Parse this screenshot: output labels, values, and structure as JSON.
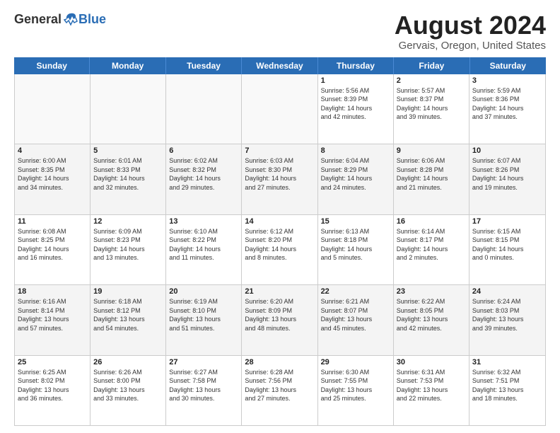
{
  "logo": {
    "general": "General",
    "blue": "Blue"
  },
  "title": "August 2024",
  "subtitle": "Gervais, Oregon, United States",
  "header_days": [
    "Sunday",
    "Monday",
    "Tuesday",
    "Wednesday",
    "Thursday",
    "Friday",
    "Saturday"
  ],
  "rows": [
    [
      {
        "day": "",
        "text": "",
        "empty": true
      },
      {
        "day": "",
        "text": "",
        "empty": true
      },
      {
        "day": "",
        "text": "",
        "empty": true
      },
      {
        "day": "",
        "text": "",
        "empty": true
      },
      {
        "day": "1",
        "text": "Sunrise: 5:56 AM\nSunset: 8:39 PM\nDaylight: 14 hours\nand 42 minutes."
      },
      {
        "day": "2",
        "text": "Sunrise: 5:57 AM\nSunset: 8:37 PM\nDaylight: 14 hours\nand 39 minutes."
      },
      {
        "day": "3",
        "text": "Sunrise: 5:59 AM\nSunset: 8:36 PM\nDaylight: 14 hours\nand 37 minutes."
      }
    ],
    [
      {
        "day": "4",
        "text": "Sunrise: 6:00 AM\nSunset: 8:35 PM\nDaylight: 14 hours\nand 34 minutes."
      },
      {
        "day": "5",
        "text": "Sunrise: 6:01 AM\nSunset: 8:33 PM\nDaylight: 14 hours\nand 32 minutes."
      },
      {
        "day": "6",
        "text": "Sunrise: 6:02 AM\nSunset: 8:32 PM\nDaylight: 14 hours\nand 29 minutes."
      },
      {
        "day": "7",
        "text": "Sunrise: 6:03 AM\nSunset: 8:30 PM\nDaylight: 14 hours\nand 27 minutes."
      },
      {
        "day": "8",
        "text": "Sunrise: 6:04 AM\nSunset: 8:29 PM\nDaylight: 14 hours\nand 24 minutes."
      },
      {
        "day": "9",
        "text": "Sunrise: 6:06 AM\nSunset: 8:28 PM\nDaylight: 14 hours\nand 21 minutes."
      },
      {
        "day": "10",
        "text": "Sunrise: 6:07 AM\nSunset: 8:26 PM\nDaylight: 14 hours\nand 19 minutes."
      }
    ],
    [
      {
        "day": "11",
        "text": "Sunrise: 6:08 AM\nSunset: 8:25 PM\nDaylight: 14 hours\nand 16 minutes."
      },
      {
        "day": "12",
        "text": "Sunrise: 6:09 AM\nSunset: 8:23 PM\nDaylight: 14 hours\nand 13 minutes."
      },
      {
        "day": "13",
        "text": "Sunrise: 6:10 AM\nSunset: 8:22 PM\nDaylight: 14 hours\nand 11 minutes."
      },
      {
        "day": "14",
        "text": "Sunrise: 6:12 AM\nSunset: 8:20 PM\nDaylight: 14 hours\nand 8 minutes."
      },
      {
        "day": "15",
        "text": "Sunrise: 6:13 AM\nSunset: 8:18 PM\nDaylight: 14 hours\nand 5 minutes."
      },
      {
        "day": "16",
        "text": "Sunrise: 6:14 AM\nSunset: 8:17 PM\nDaylight: 14 hours\nand 2 minutes."
      },
      {
        "day": "17",
        "text": "Sunrise: 6:15 AM\nSunset: 8:15 PM\nDaylight: 14 hours\nand 0 minutes."
      }
    ],
    [
      {
        "day": "18",
        "text": "Sunrise: 6:16 AM\nSunset: 8:14 PM\nDaylight: 13 hours\nand 57 minutes."
      },
      {
        "day": "19",
        "text": "Sunrise: 6:18 AM\nSunset: 8:12 PM\nDaylight: 13 hours\nand 54 minutes."
      },
      {
        "day": "20",
        "text": "Sunrise: 6:19 AM\nSunset: 8:10 PM\nDaylight: 13 hours\nand 51 minutes."
      },
      {
        "day": "21",
        "text": "Sunrise: 6:20 AM\nSunset: 8:09 PM\nDaylight: 13 hours\nand 48 minutes."
      },
      {
        "day": "22",
        "text": "Sunrise: 6:21 AM\nSunset: 8:07 PM\nDaylight: 13 hours\nand 45 minutes."
      },
      {
        "day": "23",
        "text": "Sunrise: 6:22 AM\nSunset: 8:05 PM\nDaylight: 13 hours\nand 42 minutes."
      },
      {
        "day": "24",
        "text": "Sunrise: 6:24 AM\nSunset: 8:03 PM\nDaylight: 13 hours\nand 39 minutes."
      }
    ],
    [
      {
        "day": "25",
        "text": "Sunrise: 6:25 AM\nSunset: 8:02 PM\nDaylight: 13 hours\nand 36 minutes."
      },
      {
        "day": "26",
        "text": "Sunrise: 6:26 AM\nSunset: 8:00 PM\nDaylight: 13 hours\nand 33 minutes."
      },
      {
        "day": "27",
        "text": "Sunrise: 6:27 AM\nSunset: 7:58 PM\nDaylight: 13 hours\nand 30 minutes."
      },
      {
        "day": "28",
        "text": "Sunrise: 6:28 AM\nSunset: 7:56 PM\nDaylight: 13 hours\nand 27 minutes."
      },
      {
        "day": "29",
        "text": "Sunrise: 6:30 AM\nSunset: 7:55 PM\nDaylight: 13 hours\nand 25 minutes."
      },
      {
        "day": "30",
        "text": "Sunrise: 6:31 AM\nSunset: 7:53 PM\nDaylight: 13 hours\nand 22 minutes."
      },
      {
        "day": "31",
        "text": "Sunrise: 6:32 AM\nSunset: 7:51 PM\nDaylight: 13 hours\nand 18 minutes."
      }
    ]
  ]
}
